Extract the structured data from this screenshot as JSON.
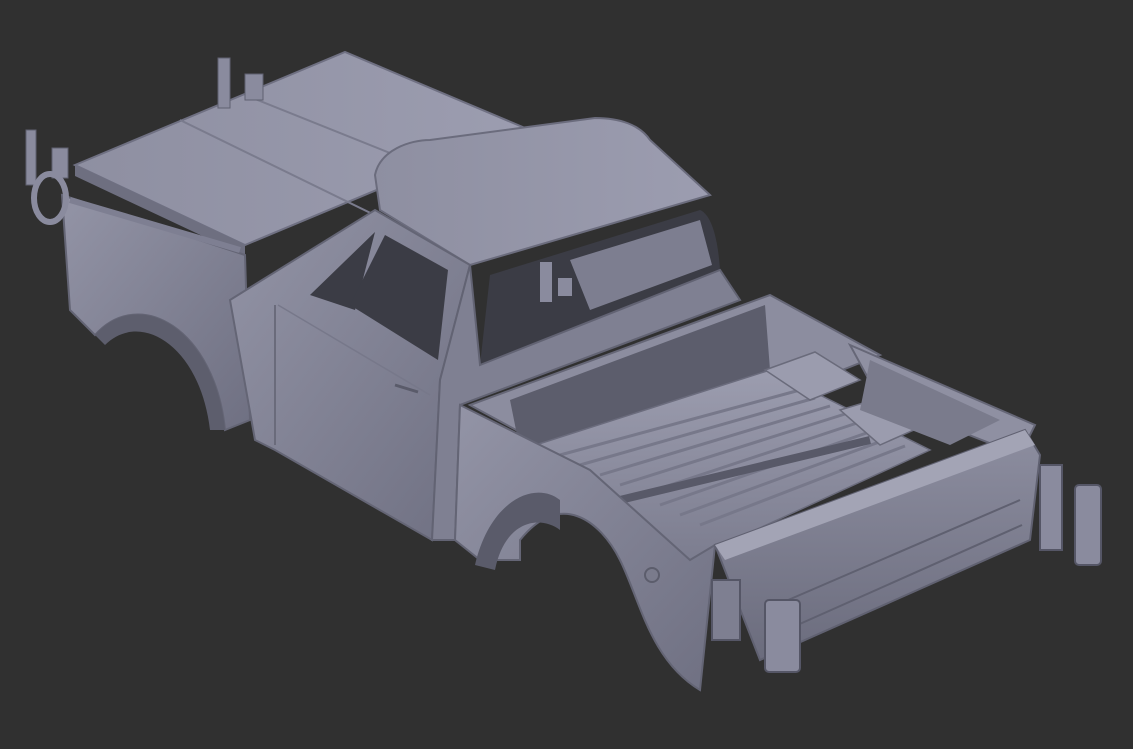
{
  "scene": {
    "background_color": "#303030",
    "model_color": "#8a8b9e",
    "model_shadow_color": "#6c6d7e",
    "model_highlight_color": "#a3a4b5",
    "dark_opening_color": "#3b3c45"
  }
}
